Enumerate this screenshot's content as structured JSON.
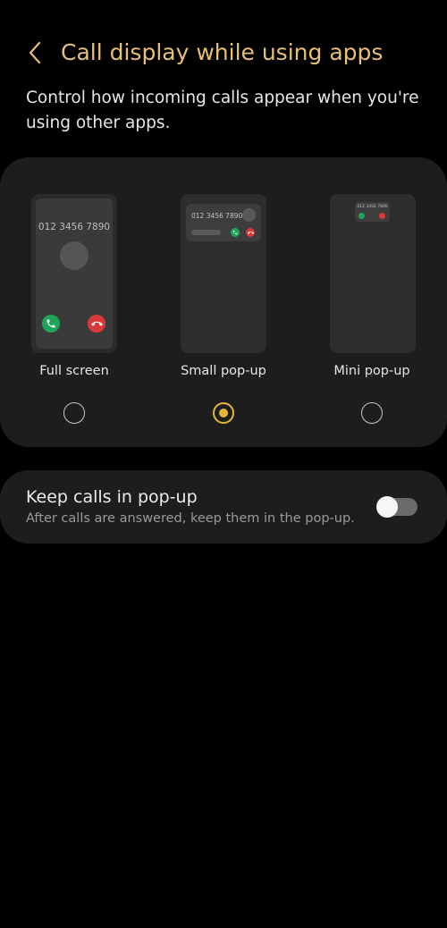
{
  "header": {
    "back_icon": "chevron-left-icon",
    "title": "Call display while using apps"
  },
  "description": "Control how incoming calls appear when you're using other apps.",
  "options": [
    {
      "id": "full_screen",
      "label": "Full screen",
      "preview_number": "012 3456 7890",
      "selected": false
    },
    {
      "id": "small_popup",
      "label": "Small pop-up",
      "preview_number": "012 3456 7890",
      "selected": true
    },
    {
      "id": "mini_popup",
      "label": "Mini pop-up",
      "preview_number": "012 3456 7890",
      "selected": false
    }
  ],
  "keep_in_popup": {
    "title": "Keep calls in pop-up",
    "subtitle": "After calls are answered, keep them in the pop-up.",
    "enabled": false
  },
  "colors": {
    "background": "#000000",
    "card": "#1d1d1d",
    "title_accent": "#e8c074",
    "radio_selected": "#e6b53a",
    "accept_green": "#1fa55a",
    "decline_red": "#d8393b"
  }
}
